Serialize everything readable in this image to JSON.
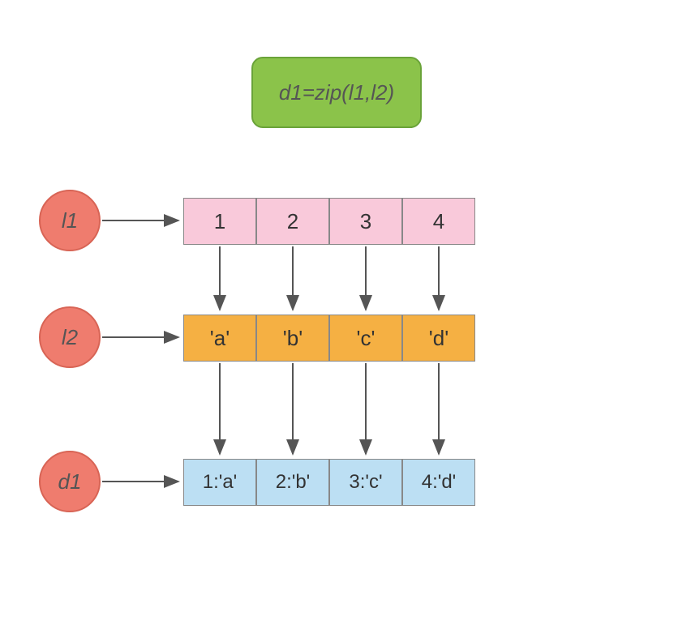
{
  "title": "d1=zip(l1,l2)",
  "nodes": {
    "l1": "l1",
    "l2": "l2",
    "d1": "d1"
  },
  "l1_values": [
    "1",
    "2",
    "3",
    "4"
  ],
  "l2_values": [
    "'a'",
    "'b'",
    "'c'",
    "'d'"
  ],
  "d1_values": [
    "1:'a'",
    "2:'b'",
    "3:'c'",
    "4:'d'"
  ]
}
